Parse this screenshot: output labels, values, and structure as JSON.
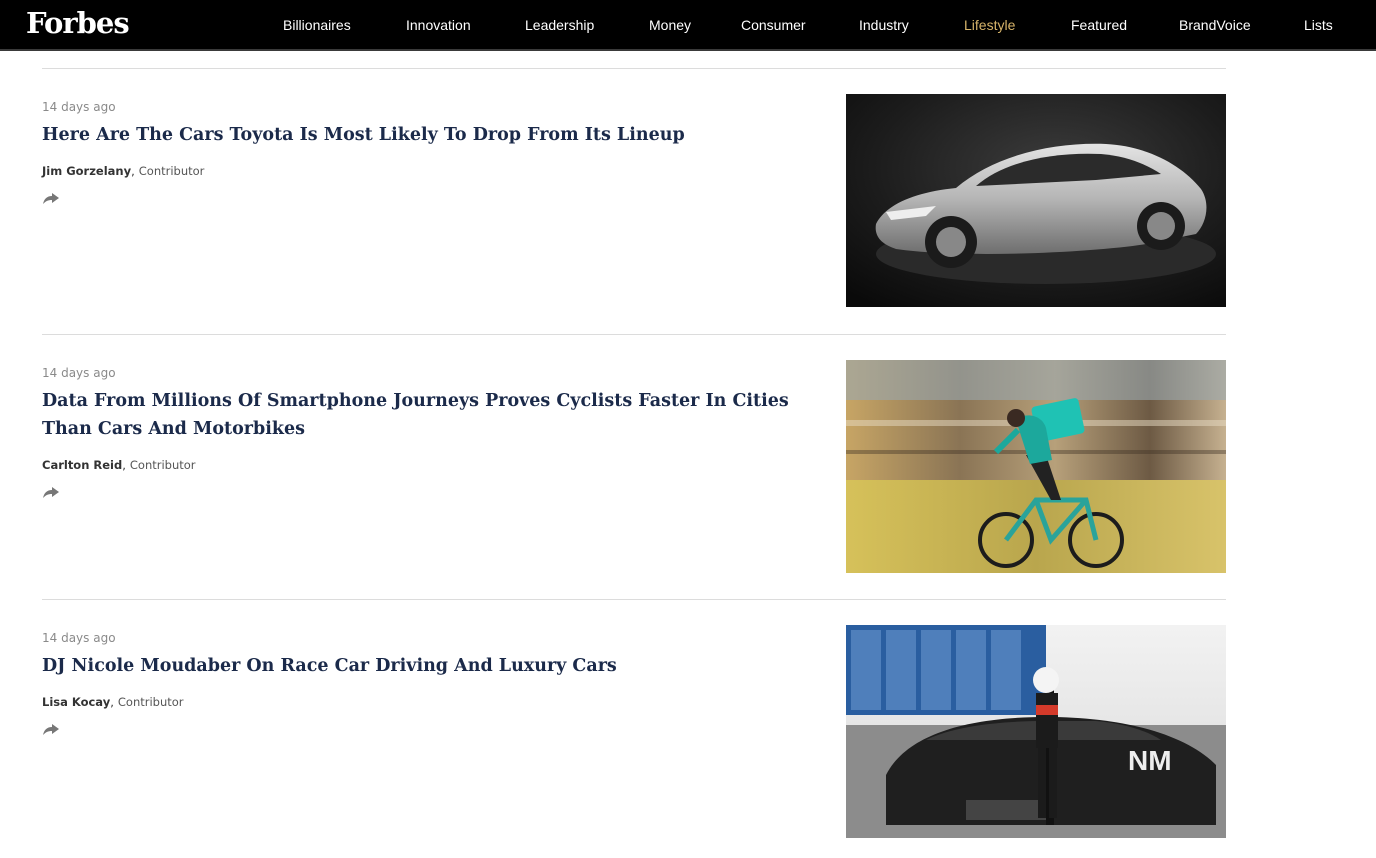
{
  "header": {
    "logo": "Forbes",
    "nav": [
      {
        "label": "Billionaires",
        "active": false
      },
      {
        "label": "Innovation",
        "active": false
      },
      {
        "label": "Leadership",
        "active": false
      },
      {
        "label": "Money",
        "active": false
      },
      {
        "label": "Consumer",
        "active": false
      },
      {
        "label": "Industry",
        "active": false
      },
      {
        "label": "Lifestyle",
        "active": true
      },
      {
        "label": "Featured",
        "active": false
      },
      {
        "label": "BrandVoice",
        "active": false
      },
      {
        "label": "Lists",
        "active": false
      }
    ],
    "active_color": "#d7b46a"
  },
  "articles": [
    {
      "timestamp": "14 days ago",
      "headline": "Here Are The Cars Toyota Is Most Likely To Drop From Its Lineup",
      "author": "Jim Gorzelany",
      "role": "Contributor",
      "share_icon": "share-arrow-icon"
    },
    {
      "timestamp": "14 days ago",
      "headline": "Data From Millions Of Smartphone Journeys Proves Cyclists Faster In Cities Than Cars And Motorbikes",
      "author": "Carlton Reid",
      "role": "Contributor",
      "share_icon": "share-arrow-icon"
    },
    {
      "timestamp": "14 days ago",
      "headline": "DJ Nicole Moudaber On Race Car Driving And Luxury Cars",
      "author": "Lisa Kocay",
      "role": "Contributor",
      "share_icon": "share-arrow-icon"
    }
  ]
}
